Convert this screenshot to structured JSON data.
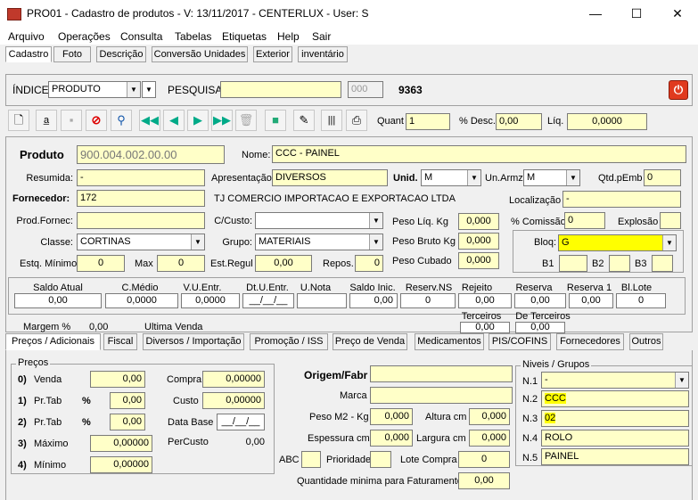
{
  "window": {
    "title": "PRO01 - Cadastro de produtos - V: 13/11/2017 - CENTERLUX - User: S",
    "minimize": "—",
    "maximize": "☐",
    "close": "✕"
  },
  "menu": [
    "Arquivo",
    "Operações",
    "Consulta",
    "Tabelas",
    "Etiquetas",
    "Help",
    "Sair"
  ],
  "top_tabs": [
    "Cadastro",
    "Foto",
    "Descrição",
    "Conversão Unidades",
    "Exterior",
    "inventário"
  ],
  "search": {
    "indice_label": "ÍNDICE",
    "indice_value": "PRODUTO",
    "pesquisa_label": "PESQUISA",
    "pesquisa_value": "",
    "code_value": "000",
    "count": "9363"
  },
  "toolbar": {
    "quant_label": "Quant",
    "quant_value": "1",
    "desc_label": "% Desc.",
    "desc_value": "0,00",
    "liq_label": "Líq.",
    "liq_value": "0,0000"
  },
  "product": {
    "produto_label": "Produto",
    "produto_value": "900.004.002.00.00",
    "nome_label": "Nome:",
    "nome_value": "CCC - PAINEL",
    "resumida_label": "Resumida:",
    "resumida_value": "-",
    "apresentacao_label": "Apresentação",
    "apresentacao_value": "DIVERSOS",
    "unid_label": "Unid.",
    "unid_value": "M",
    "unarmz_label": "Un.Armz",
    "unarmz_value": "M",
    "qtdpemb_label": "Qtd.pEmb",
    "qtdpemb_value": "0",
    "fornecedor_label": "Fornecedor:",
    "fornecedor_value": "172",
    "fornecedor_name": "TJ COMERCIO IMPORTACAO E EXPORTACAO LTDA",
    "localizacao_label": "Localização",
    "localizacao_value": "-",
    "prodfornec_label": "Prod.Fornec:",
    "prodfornec_value": "",
    "ccusto_label": "C/Custo:",
    "ccusto_value": "",
    "pesoliq_label": "Peso Líq. Kg",
    "pesoliq_value": "0,000",
    "comissao_label": "% Comissão",
    "comissao_value": "0",
    "explosao_label": "Explosão",
    "explosao_value": "",
    "classe_label": "Classe:",
    "classe_value": "CORTINAS",
    "grupo_label": "Grupo:",
    "grupo_value": "MATERIAIS",
    "pesobruto_label": "Peso Bruto Kg",
    "pesobruto_value": "0,000",
    "bloq_label": "Bloq:",
    "bloq_value": "G",
    "estqmin_label": "Estq. Mínimo",
    "estqmin_value": "0",
    "max_label": "Max",
    "max_value": "0",
    "estregul_label": "Est.Regul",
    "estregul_value": "0,00",
    "repos_label": "Repos.",
    "repos_value": "0",
    "pesocubado_label": "Peso Cubado",
    "pesocubado_value": "0,000",
    "b1_label": "B1",
    "b2_label": "B2",
    "b3_label": "B3"
  },
  "stock": {
    "headers": [
      "Saldo Atual",
      "C.Médio",
      "V.U.Entr.",
      "Dt.U.Entr.",
      "U.Nota",
      "Saldo Inic.",
      "Reserv.NS",
      "Rejeito",
      "Reserva",
      "Reserva 1",
      "Bl.Lote"
    ],
    "values": [
      "0,00",
      "0,0000",
      "0,0000",
      "__/__/__",
      "",
      "0,00",
      "0",
      "0,00",
      "0,00",
      "0,00",
      "0"
    ],
    "terceiros_label": "Terceiros",
    "terceiros_value": "0,00",
    "de_terceiros_label": "De Terceiros",
    "de_terceiros_value": "0,00",
    "margem_label": "Margem  %",
    "margem_value": "0,00",
    "ultima_venda_label": "Ultima Venda"
  },
  "sub_tabs": [
    "Preços / Adicionais",
    "Fiscal",
    "Diversos / Importação",
    "Promoção / ISS",
    "Preço de Venda",
    "Medicamentos",
    "PIS/COFINS",
    "Fornecedores",
    "Outros"
  ],
  "precos": {
    "group_label": "Preços",
    "rows": [
      {
        "num": "0)",
        "label": "Venda",
        "pct": "",
        "value": "0,00"
      },
      {
        "num": "1)",
        "label": "Pr.Tab",
        "pct": "%",
        "value": "0,00"
      },
      {
        "num": "2)",
        "label": "Pr.Tab",
        "pct": "%",
        "value": "0,00"
      },
      {
        "num": "3)",
        "label": "Máximo",
        "pct": "",
        "value": "0,00000"
      },
      {
        "num": "4)",
        "label": "Mínimo",
        "pct": "",
        "value": "0,00000"
      }
    ],
    "compra_label": "Compra",
    "compra_value": "0,00000",
    "custo_label": "Custo",
    "custo_value": "0,00000",
    "database_label": "Data Base",
    "database_value": "__/__/__",
    "percusto_label": "PerCusto",
    "percusto_value": "0,00"
  },
  "origem": {
    "origem_label": "Origem/Fabr",
    "origem_value": "",
    "marca_label": "Marca",
    "marca_value": "",
    "pesom2_label": "Peso M2 - Kg",
    "pesom2_value": "0,000",
    "altura_label": "Altura cm",
    "altura_value": "0,000",
    "espessura_label": "Espessura cm",
    "espessura_value": "0,000",
    "largura_label": "Largura cm",
    "largura_value": "0,000",
    "abc_label": "ABC",
    "abc_value": "",
    "prioridade_label": "Prioridade",
    "prioridade_value": "",
    "lotecompra_label": "Lote Compra",
    "lotecompra_value": "0",
    "qtdmin_label": "Quantidade minima para Faturamento",
    "qtdmin_value": "0,00"
  },
  "niveis": {
    "group_label": "Niveis / Grupos",
    "rows": [
      {
        "label": "N.1",
        "value": "-"
      },
      {
        "label": "N.2",
        "value": "CCC"
      },
      {
        "label": "N.3",
        "value": "02"
      },
      {
        "label": "N.4",
        "value": "ROLO"
      },
      {
        "label": "N.5",
        "value": "PAINEL"
      }
    ]
  },
  "colors": {
    "field_bg": "#ffffc8",
    "highlight": "#ffff00",
    "power_button": "#e03a1e"
  }
}
